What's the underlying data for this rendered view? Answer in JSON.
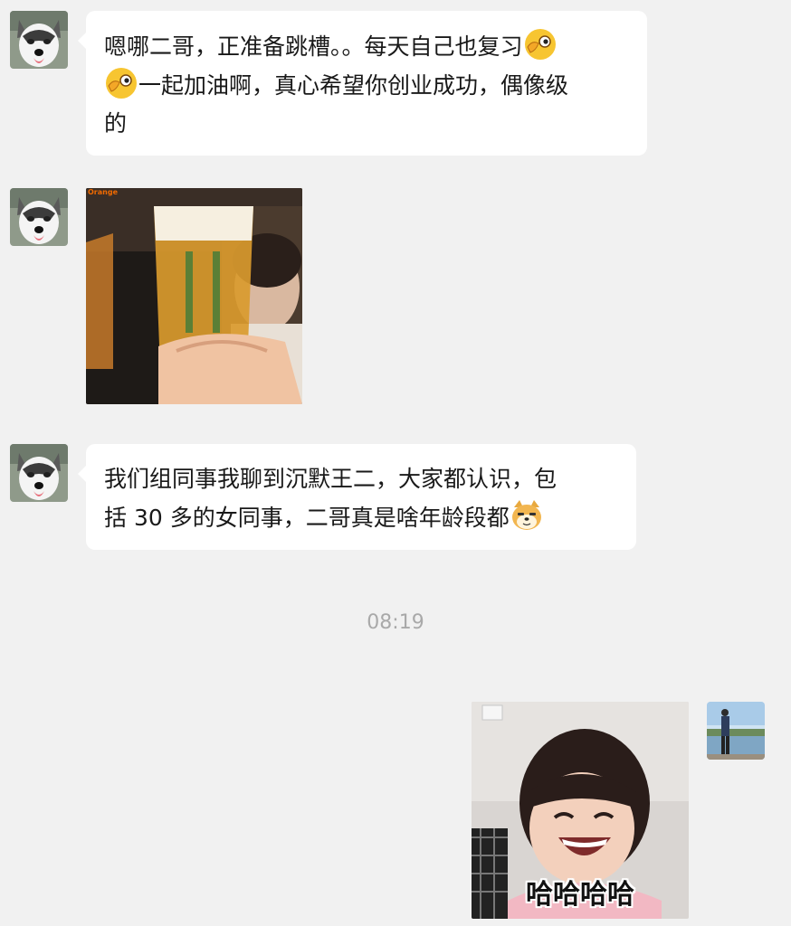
{
  "messages": [
    {
      "sender": "husky",
      "type": "text",
      "lines": [
        "嗯哪二哥，正准备跳槽。。每天自己也复习",
        "一起加油啊，真心希望你创业成功，偶像级",
        "的"
      ],
      "emoji": "ok-hand-eye-emoji"
    },
    {
      "sender": "husky",
      "type": "image",
      "watermark": "Orange",
      "content": "beer-glass-toast-photo"
    },
    {
      "sender": "husky",
      "type": "text",
      "lines": [
        "我们组同事我聊到沉默王二，大家都认识，包",
        "括 30 多的女同事，二哥真是啥年龄段都"
      ],
      "emoji": "doge-emoji"
    },
    {
      "sender": "self",
      "type": "sticker",
      "caption": "哈哈哈哈",
      "content": "laughing-girl-sticker"
    }
  ],
  "timestamp": "08:19",
  "colors": {
    "background": "#f1f1f1",
    "bubble": "#ffffff",
    "text": "#191919",
    "timestamp": "#a9a9a9"
  }
}
